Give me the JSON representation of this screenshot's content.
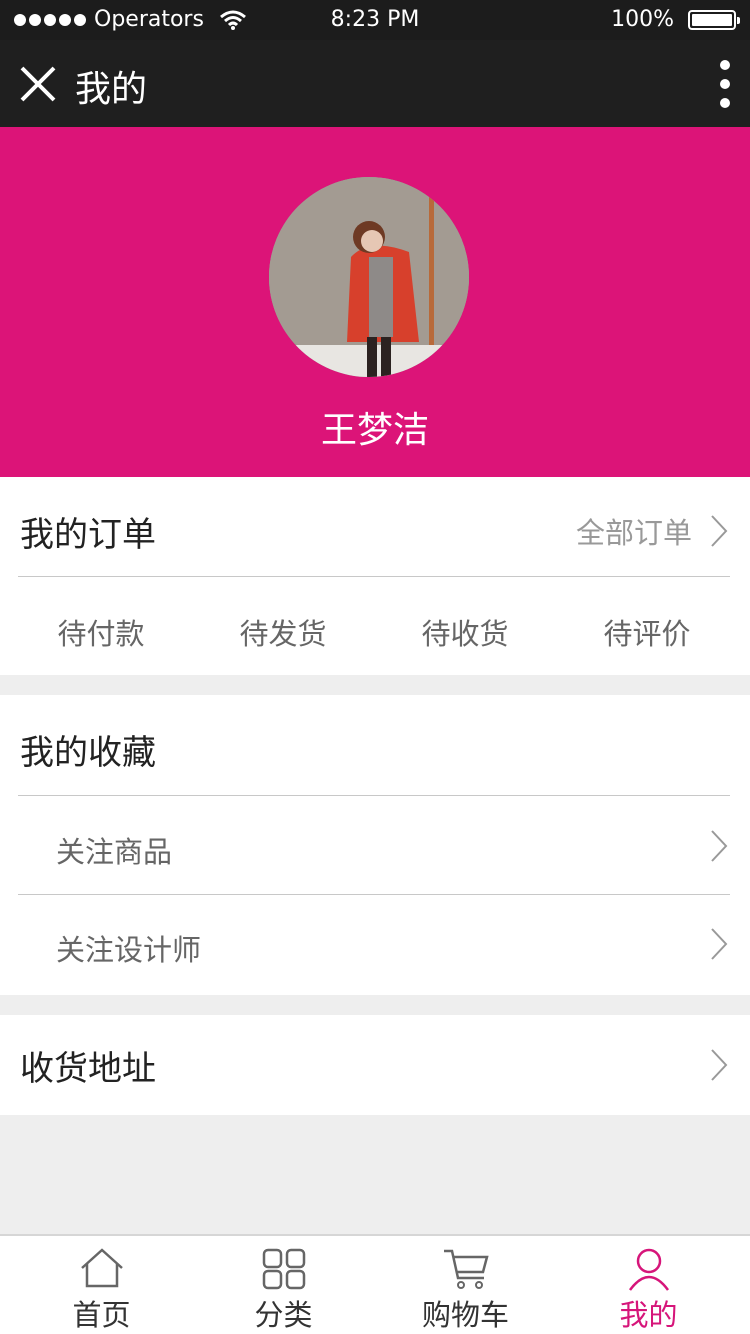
{
  "status_bar": {
    "carrier": "Operators",
    "time": "8:23 PM",
    "battery": "100%",
    "battery_level": 1.0
  },
  "nav": {
    "title": "我的",
    "close_icon": "close-icon",
    "more_icon": "more-vertical-icon"
  },
  "profile": {
    "name": "王梦洁",
    "bg_color": "#dc1478"
  },
  "orders": {
    "title": "我的订单",
    "all_label": "全部订单",
    "statuses": [
      "待付款",
      "待发货",
      "待收货",
      "待评价"
    ]
  },
  "favorites": {
    "title": "我的收藏",
    "items": [
      "关注商品",
      "关注设计师"
    ]
  },
  "address": {
    "title": "收货地址"
  },
  "tabbar": {
    "tabs": [
      {
        "label": "首页",
        "icon": "home-icon"
      },
      {
        "label": "分类",
        "icon": "grid-icon"
      },
      {
        "label": "购物车",
        "icon": "cart-icon"
      },
      {
        "label": "我的",
        "icon": "user-icon"
      }
    ],
    "active_index": 3,
    "active_color": "#d6157a"
  }
}
